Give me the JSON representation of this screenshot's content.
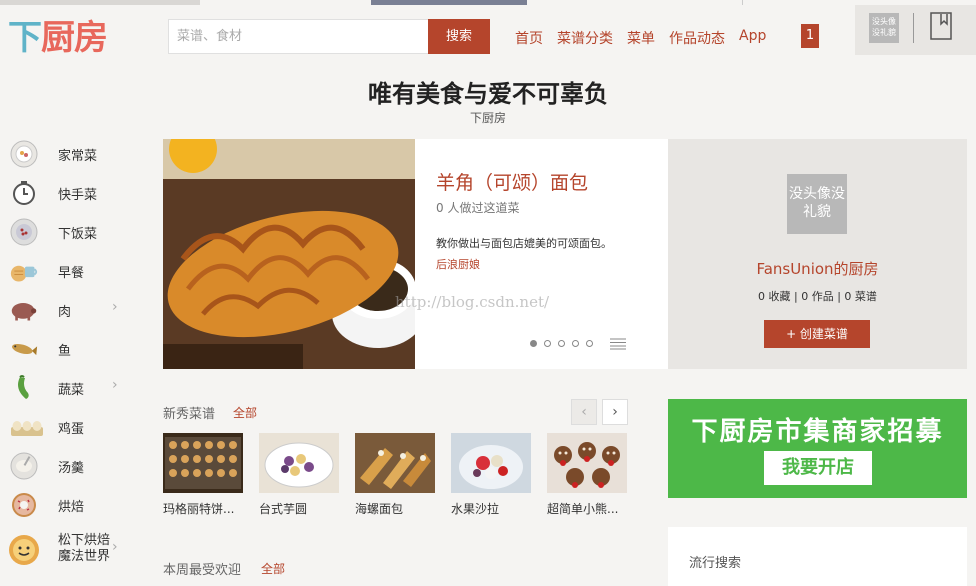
{
  "header": {
    "logo_part1": "下",
    "logo_part2": "厨房",
    "search_placeholder": "菜谱、食材",
    "search_button": "搜索",
    "nav": [
      "首页",
      "菜谱分类",
      "菜单",
      "作品动态",
      "App"
    ],
    "notification_count": "1",
    "avatar_text": "没头像没礼貌"
  },
  "headline": {
    "title": "唯有美食与爱不可辜负",
    "subtitle": "下厨房"
  },
  "sidebar": {
    "items": [
      {
        "label": "家常菜",
        "icon": "plate-icon"
      },
      {
        "label": "快手菜",
        "icon": "clock-icon"
      },
      {
        "label": "下饭菜",
        "icon": "rice-bowl-icon"
      },
      {
        "label": "早餐",
        "icon": "breakfast-icon"
      },
      {
        "label": "肉",
        "icon": "pig-icon"
      },
      {
        "label": "鱼",
        "icon": "fish-icon"
      },
      {
        "label": "蔬菜",
        "icon": "vegetable-icon"
      },
      {
        "label": "鸡蛋",
        "icon": "eggs-icon"
      },
      {
        "label": "汤羹",
        "icon": "soup-icon"
      },
      {
        "label": "烘焙",
        "icon": "donut-icon"
      },
      {
        "label": "松下烘焙",
        "icon": "bakery-icon"
      },
      {
        "label": "魔法世界",
        "icon": ""
      }
    ]
  },
  "carousel": {
    "title": "羊角（可颂）面包",
    "cooked_count": "0 人做过这道菜",
    "description": "教你做出与面包店媲美的可颂面包。",
    "author": "后浪厨娘",
    "watermark": "http://blog.csdn.net/"
  },
  "profile": {
    "avatar_text": "没头像没礼貌",
    "name": "FansUnion的厨房",
    "stats": "0 收藏  |  0 作品  |  0 菜谱",
    "create_button": "+ 创建菜谱"
  },
  "new_recipes": {
    "title": "新秀菜谱",
    "all_link": "全部",
    "items": [
      {
        "label": "玛格丽特饼..."
      },
      {
        "label": "台式芋圆"
      },
      {
        "label": "海螺面包"
      },
      {
        "label": "水果沙拉"
      },
      {
        "label": "超简单小熊..."
      }
    ]
  },
  "weekly_popular": {
    "title": "本周最受欢迎",
    "all_link": "全部"
  },
  "ad": {
    "title": "下厨房市集商家招募",
    "button": "我要开店"
  },
  "trending": {
    "label": "流行搜索"
  },
  "colors": {
    "brand_red": "#b5452c",
    "ad_green": "#4db848",
    "logo_blue": "#5fb3c8",
    "logo_red": "#e8685c"
  }
}
